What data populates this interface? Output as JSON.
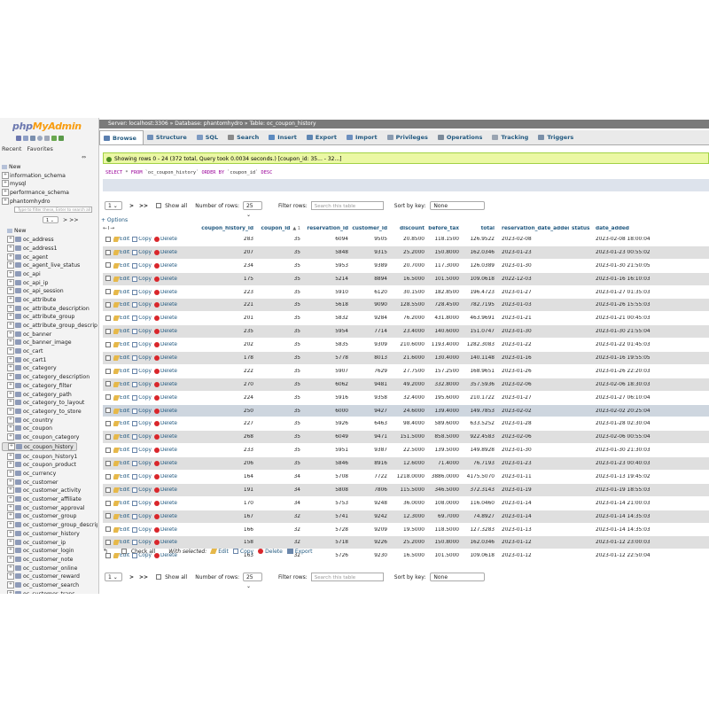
{
  "left": {
    "logo_a": "php",
    "logo_b": "MyAdmin",
    "tab_recent": "Recent",
    "tab_favorites": "Favorites",
    "filter_placeholder": "Type to filter these, Enter to search all",
    "page_value": "1",
    "page_nav": "> >>",
    "tree": [
      {
        "label": "New",
        "level": 0,
        "type": "new"
      },
      {
        "label": "information_schema",
        "level": 0,
        "type": "db"
      },
      {
        "label": "mysql",
        "level": 0,
        "type": "db"
      },
      {
        "label": "performance_schema",
        "level": 0,
        "type": "db"
      },
      {
        "label": "phantomhydro",
        "level": 0,
        "type": "db"
      },
      {
        "label": "",
        "level": 1,
        "type": "filter"
      },
      {
        "label": "",
        "level": 1,
        "type": "pager"
      },
      {
        "label": "New",
        "level": 1,
        "type": "new"
      },
      {
        "label": "oc_address",
        "level": 1,
        "type": "table"
      },
      {
        "label": "oc_address1",
        "level": 1,
        "type": "table"
      },
      {
        "label": "oc_agent",
        "level": 1,
        "type": "table"
      },
      {
        "label": "oc_agent_live_status",
        "level": 1,
        "type": "table"
      },
      {
        "label": "oc_api",
        "level": 1,
        "type": "table"
      },
      {
        "label": "oc_api_ip",
        "level": 1,
        "type": "table"
      },
      {
        "label": "oc_api_session",
        "level": 1,
        "type": "table"
      },
      {
        "label": "oc_attribute",
        "level": 1,
        "type": "table"
      },
      {
        "label": "oc_attribute_description",
        "level": 1,
        "type": "table"
      },
      {
        "label": "oc_attribute_group",
        "level": 1,
        "type": "table"
      },
      {
        "label": "oc_attribute_group_descriptic",
        "level": 1,
        "type": "table"
      },
      {
        "label": "oc_banner",
        "level": 1,
        "type": "table"
      },
      {
        "label": "oc_banner_image",
        "level": 1,
        "type": "table"
      },
      {
        "label": "oc_cart",
        "level": 1,
        "type": "table"
      },
      {
        "label": "oc_cart1",
        "level": 1,
        "type": "table"
      },
      {
        "label": "oc_category",
        "level": 1,
        "type": "table"
      },
      {
        "label": "oc_category_description",
        "level": 1,
        "type": "table"
      },
      {
        "label": "oc_category_filter",
        "level": 1,
        "type": "table"
      },
      {
        "label": "oc_category_path",
        "level": 1,
        "type": "table"
      },
      {
        "label": "oc_category_to_layout",
        "level": 1,
        "type": "table"
      },
      {
        "label": "oc_category_to_store",
        "level": 1,
        "type": "table"
      },
      {
        "label": "oc_country",
        "level": 1,
        "type": "table"
      },
      {
        "label": "oc_coupon",
        "level": 1,
        "type": "table"
      },
      {
        "label": "oc_coupon_category",
        "level": 1,
        "type": "table"
      },
      {
        "label": "oc_coupon_history",
        "level": 1,
        "type": "table",
        "selected": true
      },
      {
        "label": "oc_coupon_history1",
        "level": 1,
        "type": "table"
      },
      {
        "label": "oc_coupon_product",
        "level": 1,
        "type": "table"
      },
      {
        "label": "oc_currency",
        "level": 1,
        "type": "table"
      },
      {
        "label": "oc_customer",
        "level": 1,
        "type": "table"
      },
      {
        "label": "oc_customer_activity",
        "level": 1,
        "type": "table"
      },
      {
        "label": "oc_customer_affiliate",
        "level": 1,
        "type": "table"
      },
      {
        "label": "oc_customer_approval",
        "level": 1,
        "type": "table"
      },
      {
        "label": "oc_customer_group",
        "level": 1,
        "type": "table"
      },
      {
        "label": "oc_customer_group_descripti",
        "level": 1,
        "type": "table"
      },
      {
        "label": "oc_customer_history",
        "level": 1,
        "type": "table"
      },
      {
        "label": "oc_customer_ip",
        "level": 1,
        "type": "table"
      },
      {
        "label": "oc_customer_login",
        "level": 1,
        "type": "table"
      },
      {
        "label": "oc_customer_note",
        "level": 1,
        "type": "table"
      },
      {
        "label": "oc_customer_online",
        "level": 1,
        "type": "table"
      },
      {
        "label": "oc_customer_reward",
        "level": 1,
        "type": "table"
      },
      {
        "label": "oc_customer_search",
        "level": 1,
        "type": "table"
      },
      {
        "label": "oc_customer_trans",
        "level": 1,
        "type": "table"
      }
    ]
  },
  "breadcrumb": {
    "server": "Server: localhost:3306",
    "database": "Database: phantomhydro",
    "table": "Table: oc_coupon_history",
    "sep": "»"
  },
  "tabs": [
    {
      "label": "Browse",
      "color": "#5b7fb0",
      "active": true
    },
    {
      "label": "Structure",
      "color": "#6f8fb9"
    },
    {
      "label": "SQL",
      "color": "#7d9ac2"
    },
    {
      "label": "Search",
      "color": "#8a8a8a"
    },
    {
      "label": "Insert",
      "color": "#5c8ac0"
    },
    {
      "label": "Export",
      "color": "#5e86b3"
    },
    {
      "label": "Import",
      "color": "#6c8fbf"
    },
    {
      "label": "Privileges",
      "color": "#8a9bb0"
    },
    {
      "label": "Operations",
      "color": "#7c8a99"
    },
    {
      "label": "Tracking",
      "color": "#9aa4b1"
    },
    {
      "label": "Triggers",
      "color": "#7a8fa8"
    }
  ],
  "message": "Showing rows 0 - 24 (372 total, Query took 0.0034 seconds.) [coupon_id: 35... - 32...]",
  "sql": {
    "kw1": "SELECT",
    "star": "*",
    "kw2": "FROM",
    "table": "`oc_coupon_history`",
    "kw3": "ORDER BY",
    "col": "`coupon_id`",
    "kw4": "DESC"
  },
  "nav": {
    "page": "1",
    "next": ">",
    "last": ">>",
    "show_all": "Show all",
    "rows_label": "Number of rows:",
    "rows_value": "25",
    "filter_label": "Filter rows:",
    "filter_placeholder": "Search this table",
    "sort_label": "Sort by key:",
    "sort_value": "None"
  },
  "options_link": "+ Options",
  "arrows": "←T→",
  "columns": [
    "coupon_history_id",
    "coupon_id",
    "reservation_id",
    "customer_id",
    "discount",
    "before_tax",
    "total",
    "reservation_date_added",
    "status",
    "date_added"
  ],
  "sort_indicator": "▲ 1",
  "actions": {
    "edit": "Edit",
    "copy": "Copy",
    "delete": "Delete"
  },
  "rows": [
    [
      "283",
      "35",
      "6094",
      "9505",
      "20.8500",
      "118.1500",
      "126.9522",
      "2023-02-08",
      "",
      "2023-02-08 18:00:04"
    ],
    [
      "207",
      "35",
      "5848",
      "9315",
      "25.2000",
      "150.8000",
      "162.0346",
      "2023-01-23",
      "",
      "2023-01-23 00:55:02"
    ],
    [
      "234",
      "35",
      "5953",
      "9389",
      "20.7000",
      "117.3000",
      "126.0389",
      "2023-01-30",
      "",
      "2023-01-30 21:50:05"
    ],
    [
      "175",
      "35",
      "5214",
      "8894",
      "16.5000",
      "101.5000",
      "109.0618",
      "2022-12-03",
      "",
      "2023-01-16 16:10:03"
    ],
    [
      "223",
      "35",
      "5910",
      "6120",
      "30.1500",
      "182.8500",
      "196.4723",
      "2023-01-27",
      "",
      "2023-01-27 01:35:03"
    ],
    [
      "221",
      "35",
      "5618",
      "9090",
      "128.5500",
      "728.4500",
      "782.7195",
      "2023-01-03",
      "",
      "2023-01-26 15:55:03"
    ],
    [
      "201",
      "35",
      "5832",
      "9284",
      "76.2000",
      "431.8000",
      "463.9691",
      "2023-01-21",
      "",
      "2023-01-21 00:45:03"
    ],
    [
      "235",
      "35",
      "5954",
      "7714",
      "23.4000",
      "140.6000",
      "151.0747",
      "2023-01-30",
      "",
      "2023-01-30 21:55:04"
    ],
    [
      "202",
      "35",
      "5835",
      "9309",
      "210.6000",
      "1193.4000",
      "1282.3083",
      "2023-01-22",
      "",
      "2023-01-22 01:45:03"
    ],
    [
      "178",
      "35",
      "5778",
      "8013",
      "21.6000",
      "130.4000",
      "140.1148",
      "2023-01-16",
      "",
      "2023-01-16 19:55:05"
    ],
    [
      "222",
      "35",
      "5907",
      "7629",
      "27.7500",
      "157.2500",
      "168.9651",
      "2023-01-26",
      "",
      "2023-01-26 22:20:03"
    ],
    [
      "270",
      "35",
      "6062",
      "9481",
      "49.2000",
      "332.8000",
      "357.5936",
      "2023-02-06",
      "",
      "2023-02-06 18:30:03"
    ],
    [
      "224",
      "35",
      "5916",
      "9358",
      "32.4000",
      "195.6000",
      "210.1722",
      "2023-01-27",
      "",
      "2023-01-27 06:10:04"
    ],
    [
      "250",
      "35",
      "6000",
      "9427",
      "24.6000",
      "139.4000",
      "149.7853",
      "2023-02-02",
      "",
      "2023-02-02 20:25:04"
    ],
    [
      "227",
      "35",
      "5926",
      "6463",
      "98.4000",
      "589.6000",
      "633.5252",
      "2023-01-28",
      "",
      "2023-01-28 02:30:04"
    ],
    [
      "268",
      "35",
      "6049",
      "9471",
      "151.5000",
      "858.5000",
      "922.4583",
      "2023-02-06",
      "",
      "2023-02-06 00:55:04"
    ],
    [
      "233",
      "35",
      "5951",
      "9387",
      "22.5000",
      "139.5000",
      "149.8928",
      "2023-01-30",
      "",
      "2023-01-30 21:30:03"
    ],
    [
      "206",
      "35",
      "5846",
      "8916",
      "12.6000",
      "71.4000",
      "76.7193",
      "2023-01-23",
      "",
      "2023-01-23 00:40:03"
    ],
    [
      "164",
      "34",
      "5708",
      "7722",
      "1218.0000",
      "3886.0000",
      "4175.5070",
      "2023-01-11",
      "",
      "2023-01-13 19:45:02"
    ],
    [
      "191",
      "34",
      "5808",
      "7806",
      "115.5000",
      "346.5000",
      "372.3143",
      "2023-01-19",
      "",
      "2023-01-19 18:55:03"
    ],
    [
      "170",
      "34",
      "5753",
      "9248",
      "36.0000",
      "108.0000",
      "116.0460",
      "2023-01-14",
      "",
      "2023-01-14 21:00:03"
    ],
    [
      "167",
      "32",
      "5741",
      "9242",
      "12.3000",
      "69.7000",
      "74.8927",
      "2023-01-14",
      "",
      "2023-01-14 14:35:03"
    ],
    [
      "166",
      "32",
      "5728",
      "9209",
      "19.5000",
      "118.5000",
      "127.3283",
      "2023-01-13",
      "",
      "2023-01-14 14:35:03"
    ],
    [
      "158",
      "32",
      "5718",
      "9226",
      "25.2000",
      "150.8000",
      "162.0346",
      "2023-01-12",
      "",
      "2023-01-12 23:00:03"
    ],
    [
      "163",
      "32",
      "5726",
      "9230",
      "16.5000",
      "101.5000",
      "109.0618",
      "2023-01-12",
      "",
      "2023-01-12 22:50:04"
    ]
  ],
  "bottom": {
    "check_all": "Check all",
    "with_selected": "With selected:",
    "edit": "Edit",
    "copy": "Copy",
    "delete": "Delete",
    "export": "Export"
  },
  "colors": {
    "link": "#235a81",
    "highlight_row": "#ced6df",
    "even_row": "#dfdfdf",
    "success_bg": "#ebf8a4"
  }
}
